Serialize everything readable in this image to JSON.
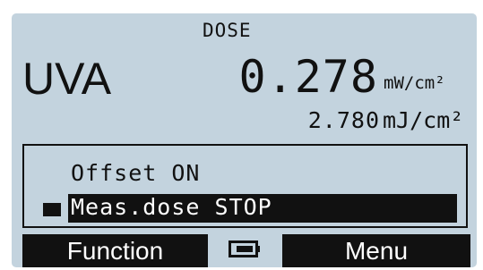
{
  "display": {
    "mode_label": "DOSE",
    "channel": "UVA",
    "irradiance_value": "0.278",
    "irradiance_unit": "mW/cm²",
    "dose_value": "2.780",
    "dose_unit": "mJ/cm²"
  },
  "menu": {
    "items": [
      {
        "label": "Offset ON",
        "selected": false
      },
      {
        "label": "Meas.dose STOP",
        "selected": true
      }
    ]
  },
  "softkeys": {
    "left": "Function",
    "right": "Menu"
  },
  "icons": {
    "battery": "battery-icon",
    "cursor": "selection-cursor-icon"
  },
  "colors": {
    "lcd_background": "#c3d3de",
    "ink": "#111111"
  }
}
